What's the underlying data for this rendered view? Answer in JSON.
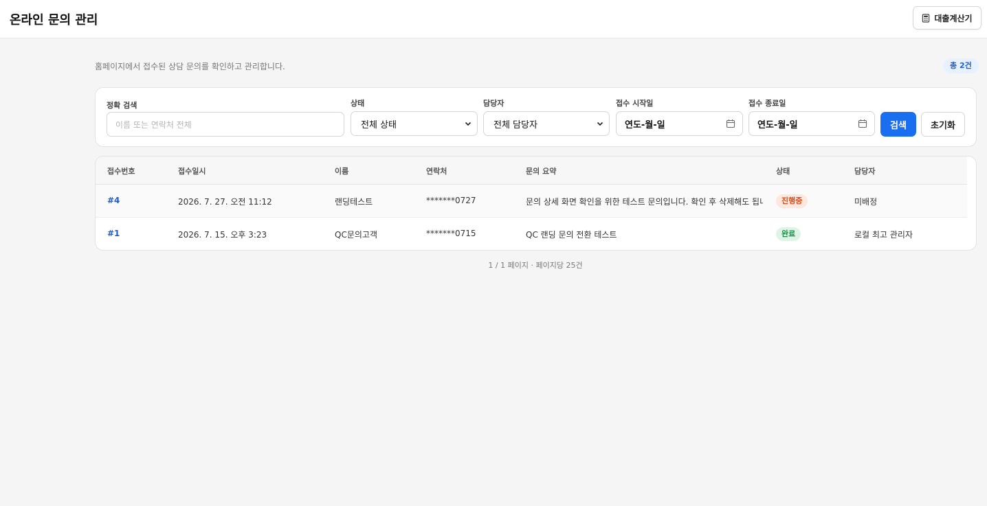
{
  "header": {
    "title": "온라인 문의 관리",
    "calc_button": "대출계산기"
  },
  "intro": {
    "subtitle": "홈페이지에서 접수된 상담 문의를 확인하고 관리합니다.",
    "total": "총 2건"
  },
  "filters": {
    "search_label": "정확 검색",
    "search_placeholder": "이름 또는 연락처 전체",
    "status_label": "상태",
    "status_value": "전체 상태",
    "assignee_label": "담당자",
    "assignee_value": "전체 담당자",
    "start_label": "접수 시작일",
    "start_value": "연도-월-일",
    "end_label": "접수 종료일",
    "end_value": "연도-월-일",
    "search_button": "검색",
    "reset_button": "초기화"
  },
  "table": {
    "columns": [
      "접수번호",
      "접수일시",
      "이름",
      "연락처",
      "문의 요약",
      "상태",
      "담당자"
    ],
    "rows": [
      {
        "id": "#4",
        "date": "2026. 7. 27. 오전 11:12",
        "name": "랜딩테스트",
        "phone": "*******0727",
        "summary": "문의 상세 화면 확인을 위한 테스트 문의입니다. 확인 후 삭제해도 됩니...",
        "status": "진행중",
        "assignee": "미배정"
      },
      {
        "id": "#1",
        "date": "2026. 7. 15. 오후 3:23",
        "name": "QC문의고객",
        "phone": "*******0715",
        "summary": "QC 랜딩 문의 전환 테스트",
        "status": "완료",
        "assignee": "로컬 최고 관리자"
      }
    ]
  },
  "pagination": {
    "text": "1 / 1 페이지 · 페이지당 25건"
  },
  "colors": {
    "primary": "#1a6ef0",
    "link": "#1a5fd6",
    "status_progress_bg": "#fde7df",
    "status_progress_fg": "#d0501e",
    "status_done_bg": "#def5e6",
    "status_done_fg": "#1f8a48"
  }
}
